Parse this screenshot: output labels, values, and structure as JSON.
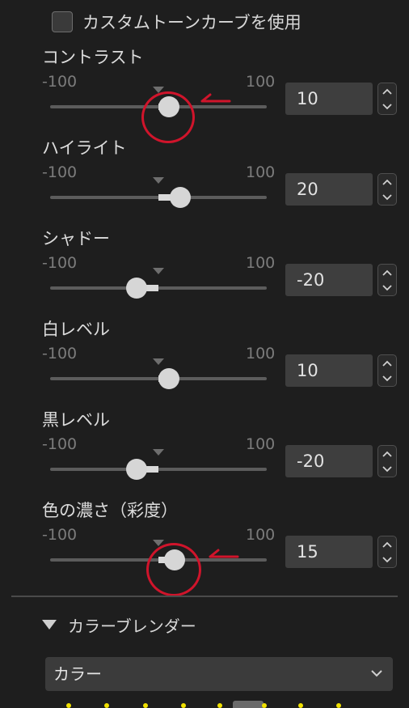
{
  "custom_curve": {
    "label": "カスタムトーンカーブを使用",
    "checked": false
  },
  "range_labels": {
    "min": "-100",
    "max": "100"
  },
  "sliders": [
    {
      "name": "contrast",
      "label": "コントラスト",
      "value": 10
    },
    {
      "name": "highlights",
      "label": "ハイライト",
      "value": 20
    },
    {
      "name": "shadows",
      "label": "シャドー",
      "value": -20
    },
    {
      "name": "whites",
      "label": "白レベル",
      "value": 10
    },
    {
      "name": "blacks",
      "label": "黒レベル",
      "value": -20
    },
    {
      "name": "saturation",
      "label": "色の濃さ（彩度）",
      "value": 15
    }
  ],
  "slider_min": -100,
  "slider_max": 100,
  "color_blender": {
    "header": "カラーブレンダー",
    "expanded": true,
    "dropdown_value": "カラー"
  },
  "annotation_color": "#d0142b",
  "colors": {
    "background": "#1e1e1e",
    "field": "#3e3e3e",
    "thumb": "#d6d6d6",
    "palette_dot": "#f0e000"
  }
}
